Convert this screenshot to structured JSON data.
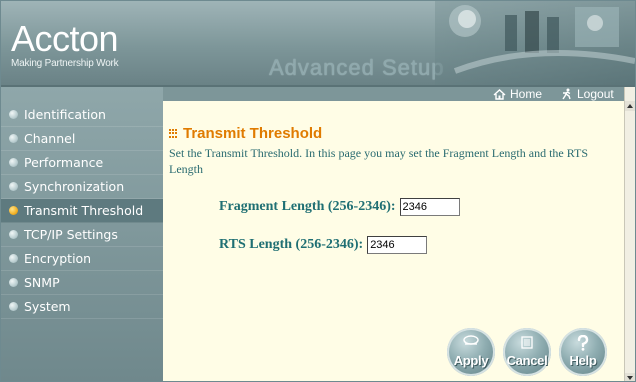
{
  "header": {
    "brand": "Accton",
    "tagline": "Making Partnership Work",
    "section": "Advanced Setup"
  },
  "topbar": {
    "home_label": "Home",
    "logout_label": "Logout"
  },
  "sidebar": {
    "items": [
      {
        "label": "Identification",
        "active": false
      },
      {
        "label": "Channel",
        "active": false
      },
      {
        "label": "Performance",
        "active": false
      },
      {
        "label": "Synchronization",
        "active": false
      },
      {
        "label": "Transmit Threshold",
        "active": true
      },
      {
        "label": "TCP/IP Settings",
        "active": false
      },
      {
        "label": "Encryption",
        "active": false
      },
      {
        "label": "SNMP",
        "active": false
      },
      {
        "label": "System",
        "active": false
      }
    ]
  },
  "main": {
    "title": "Transmit Threshold",
    "description": "Set the Transmit Threshold. In this page you may set the Fragment Length and the RTS Length",
    "fragment_label": "Fragment Length (256-2346):",
    "fragment_value": "2346",
    "rts_label": "RTS Length (256-2346):",
    "rts_value": "2346"
  },
  "buttons": {
    "apply": "Apply",
    "cancel": "Cancel",
    "help": "Help"
  },
  "colors": {
    "title": "#e07b00",
    "text": "#1f6f73",
    "content_bg": "#fffde6",
    "sidebar": "#7d9699"
  }
}
